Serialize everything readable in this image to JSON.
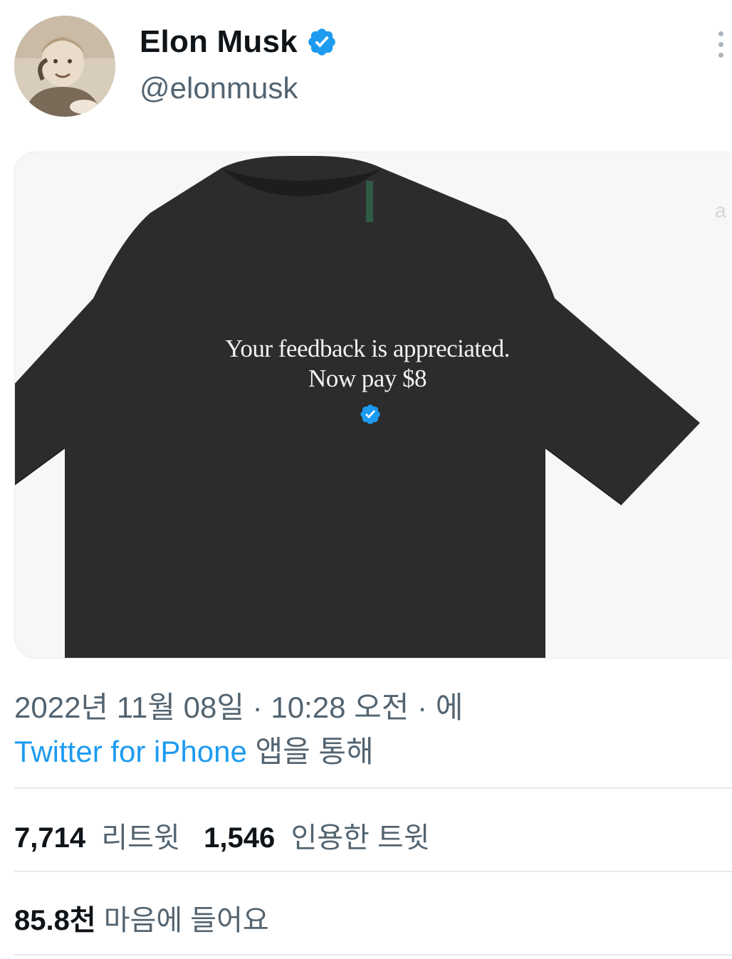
{
  "author": {
    "display_name": "Elon Musk",
    "handle": "@elonmusk",
    "verified": true
  },
  "media": {
    "shirt_text_line1": "Your feedback is appreciated.",
    "shirt_text_line2": "Now pay $8",
    "watermark_fragment": "a"
  },
  "meta": {
    "timestamp": "2022년 11월 08일 · 10:28 오전 · 에",
    "source": "Twitter for iPhone",
    "source_suffix": " 앱을 통해"
  },
  "stats": {
    "retweets_count": "7,714",
    "retweets_label": "리트윗",
    "quotes_count": "1,546",
    "quotes_label": "인용한 트윗",
    "likes_count": "85.8천",
    "likes_label": "마음에 들어요"
  },
  "colors": {
    "link": "#1d9bf0",
    "secondary_text": "#536471",
    "shirt": "#2b2b2b",
    "verified": "#1d9bf0"
  },
  "icons": {
    "verified": "verified-badge-icon",
    "more": "more-vertical-icon"
  }
}
